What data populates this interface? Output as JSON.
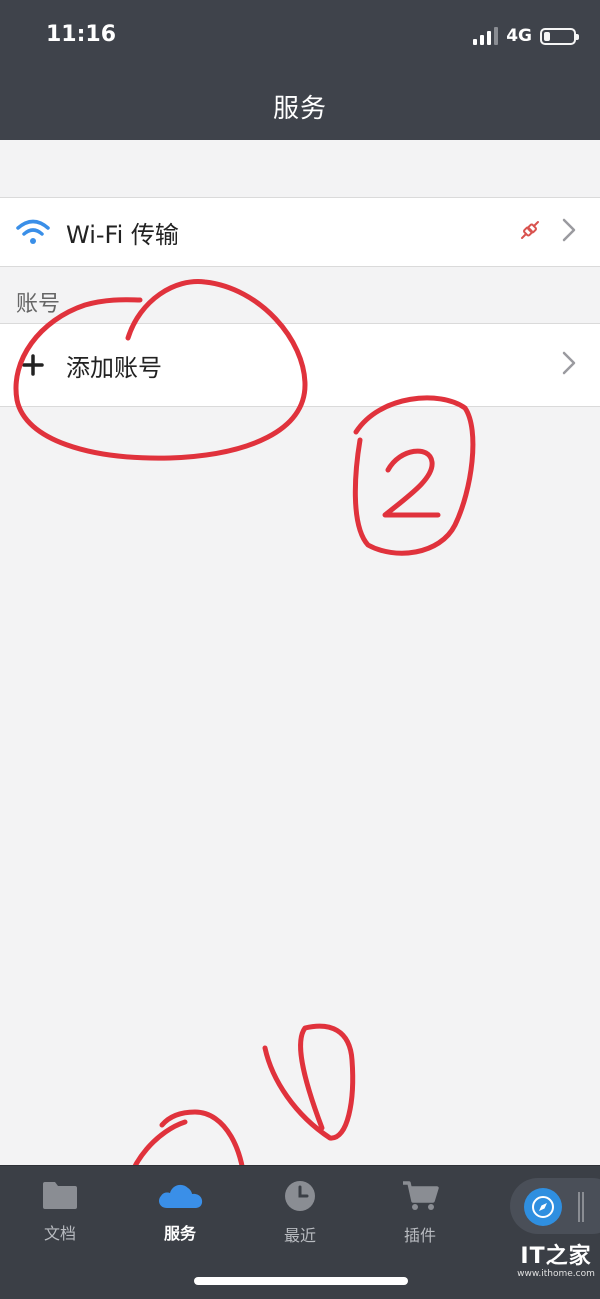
{
  "status_bar": {
    "time": "11:16",
    "network": "4G"
  },
  "nav": {
    "title": "服务"
  },
  "wifi_row": {
    "label": "Wi-Fi 传输",
    "icon": "wifi-icon",
    "status_icon": "disconnected-plug-icon"
  },
  "accounts": {
    "section_title": "账号",
    "add_label": "添加账号",
    "add_icon": "plus-icon"
  },
  "annotations": {
    "number_one": "1",
    "number_two": "2"
  },
  "tabbar": {
    "tabs": [
      {
        "label": "文档",
        "icon": "folder-icon"
      },
      {
        "label": "服务",
        "icon": "cloud-icon"
      },
      {
        "label": "最近",
        "icon": "clock-icon"
      },
      {
        "label": "插件",
        "icon": "cart-icon"
      }
    ],
    "compass_icon": "compass-icon"
  },
  "watermark": {
    "logo": "IT之家",
    "url": "www.ithome.com"
  },
  "colors": {
    "bar_bg": "#3f434b",
    "accent_blue": "#3a8fe8",
    "annotation_red": "#e0323c"
  }
}
